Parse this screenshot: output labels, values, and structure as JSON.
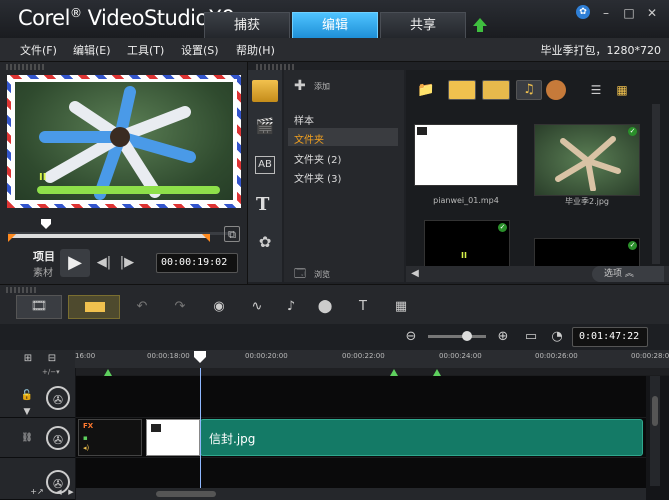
{
  "app": {
    "logo_brand": "Corel",
    "logo_product": "VideoStudio",
    "logo_version": "X9"
  },
  "tabs": [
    {
      "label": "捕获",
      "active": false
    },
    {
      "label": "编辑",
      "active": true
    },
    {
      "label": "共享",
      "active": false
    }
  ],
  "window": {
    "minimize": "–",
    "maximize": "□",
    "close": "✕"
  },
  "menu": {
    "items": [
      "文件(F)",
      "编辑(E)",
      "工具(T)",
      "设置(S)",
      "帮助(H)"
    ],
    "project_info": "毕业季打包，1280*720"
  },
  "player": {
    "mode_project": "项目",
    "mode_clip": "素材",
    "timecode": "00:00:19:02"
  },
  "library": {
    "add_label": "添加",
    "browse_label": "浏览",
    "folders": [
      "样本",
      "文件夹",
      "文件夹 (2)",
      "文件夹 (3)"
    ],
    "selected_folder": "文件夹",
    "options_label": "选项",
    "thumbnails": [
      {
        "name": "pianwei_01.mp4"
      },
      {
        "name": "毕业季2.jpg"
      },
      {
        "name": ""
      },
      {
        "name": ""
      }
    ]
  },
  "timeline": {
    "zoom_timecode": "0:01:47:22",
    "ruler": [
      "16:00",
      "00:00:18:00",
      "00:00:20:00",
      "00:00:22:00",
      "00:00:24:00",
      "00:00:26:00",
      "00:00:28:00"
    ],
    "clip_label": "信封.jpg",
    "small_clip_label": "FX"
  },
  "colors": {
    "accent": "#2aa6ef",
    "clip": "#147a66",
    "progress_green": "#8ee04a"
  }
}
